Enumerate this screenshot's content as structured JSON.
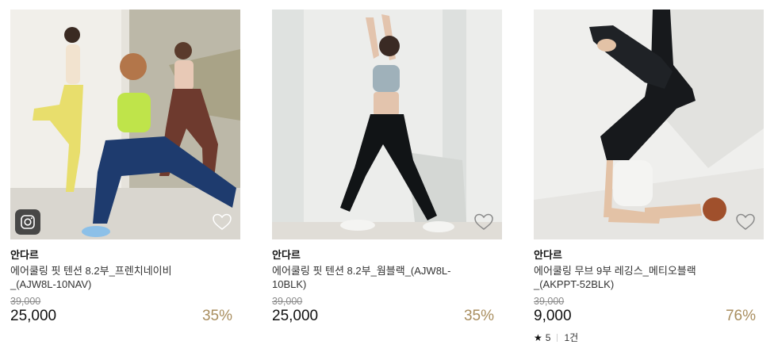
{
  "products": [
    {
      "brand": "안다르",
      "name": "에어쿨링 핏 텐션 8.2부_프렌치네이비_(AJW8L-10NAV)",
      "original_price": "39,000",
      "price": "25,000",
      "discount": "35%",
      "has_instagram_badge": true
    },
    {
      "brand": "안다르",
      "name": "에어쿨링 핏 텐션 8.2부_웜블랙_(AJW8L-10BLK)",
      "original_price": "39,000",
      "price": "25,000",
      "discount": "35%"
    },
    {
      "brand": "안다르",
      "name": "에어쿨링 무브 9부 레깅스_메티오블랙_(AKPPT-52BLK)",
      "original_price": "39,000",
      "price": "9,000",
      "discount": "76%",
      "rating": "5",
      "review_count": "1건"
    }
  ],
  "icons": {
    "wishlist": "heart-outline-icon",
    "instagram": "instagram-icon",
    "rating": "star-icon"
  },
  "colors": {
    "discount": "#a98e5f",
    "strike_price": "#8a8a8a"
  }
}
